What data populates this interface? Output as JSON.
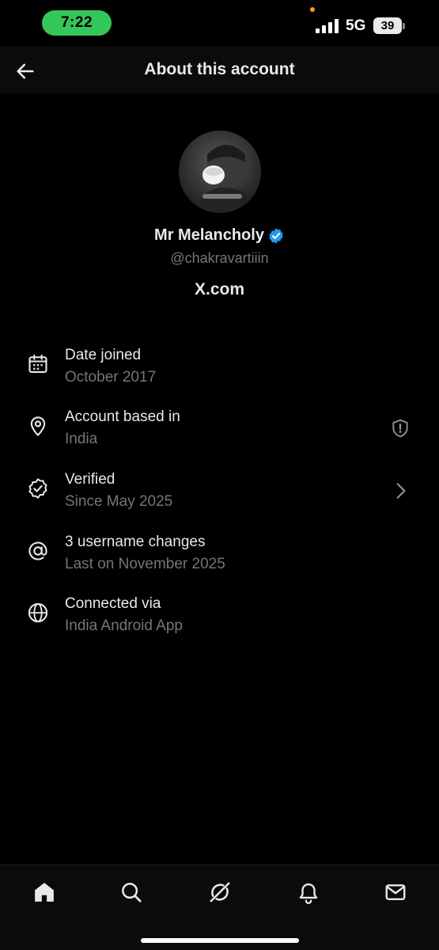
{
  "status_bar": {
    "time": "7:22",
    "network": "5G",
    "battery": "39",
    "time_pill_color": "#34c759"
  },
  "header": {
    "title": "About this account",
    "back_icon": "arrow-left-icon"
  },
  "profile": {
    "display_name": "Mr Melancholy",
    "handle": "@chakravartiiin",
    "site": "X.com",
    "verified_color": "#1d9bf0"
  },
  "info": [
    {
      "icon": "calendar-icon",
      "title": "Date joined",
      "subtitle": "October 2017"
    },
    {
      "icon": "location-pin-icon",
      "title": "Account based in",
      "subtitle": "India",
      "right_icon": "shield-alert-icon"
    },
    {
      "icon": "verified-check-icon",
      "title": "Verified",
      "subtitle": "Since May 2025",
      "right_icon": "chevron-right-icon"
    },
    {
      "icon": "at-sign-icon",
      "title": "3 username changes",
      "subtitle": "Last on November 2025"
    },
    {
      "icon": "globe-icon",
      "title": "Connected via",
      "subtitle": "India Android App"
    }
  ],
  "bottom_nav": [
    "home-icon",
    "search-icon",
    "grok-icon",
    "bell-icon",
    "mail-icon"
  ],
  "colors": {
    "background": "#000000",
    "text_primary": "#e7e9ea",
    "text_secondary": "#71767b"
  }
}
